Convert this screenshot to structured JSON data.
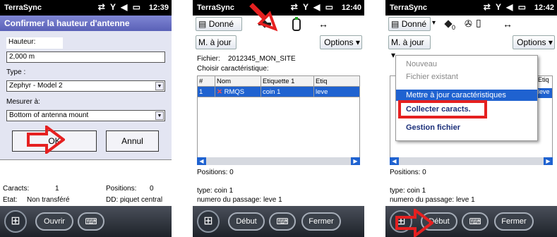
{
  "status": {
    "app": "TerraSync",
    "icons": "⇄ ᵞ ◂€",
    "times": [
      "12:39",
      "12:40",
      "12:42"
    ]
  },
  "screen1": {
    "dialog_title": "Confirmer la hauteur d'antenne",
    "hauteur_label": "Hauteur:",
    "hauteur_value": "2,000 m",
    "type_label": "Type :",
    "type_value": "Zephyr - Model 2",
    "mesurer_label": "Mesurer à:",
    "mesurer_value": "Bottom of antenna mount",
    "ok_label": "OK",
    "annul_label": "Annul",
    "caracts_label": "Caracts:",
    "caracts_value": "1",
    "positions_label": "Positions:",
    "positions_value": "0",
    "etat_label": "Etat:",
    "etat_value": "Non transféré",
    "dd_label": "DD: piquet central",
    "ouvrir_label": "Ouvrir",
    "keyboard_icon": "⌨"
  },
  "screen2": {
    "donne_label": "Donné",
    "maj_label": "M. à jour",
    "options_label": "Options",
    "fichier_label": "Fichier:",
    "fichier_value": "2012345_MON_SITE",
    "choisir_label": "Choisir caractéristique:",
    "table": {
      "headers": [
        "#",
        "Nom",
        "Etiquette 1",
        "Etiq"
      ],
      "rows": [
        [
          "1",
          "RMQS",
          "coin 1",
          "leve"
        ]
      ]
    },
    "positions_text": "Positions:  0",
    "type_text": "type: coin 1",
    "numero_text": "numero du passage: leve 1",
    "debut_label": "Début",
    "fermer_label": "Fermer"
  },
  "screen3": {
    "donne_label": "Donné",
    "maj_label": "M. à jour",
    "options_label": "Options",
    "menu": [
      "Nouveau",
      "Fichier existant",
      "Mettre à jour caractéristiques",
      "Collecter caracts.",
      "Gestion fichier"
    ],
    "etiq_label": "Etiq",
    "leve_label": "leve",
    "positions_text": "Positions:  0",
    "type_text": "type: coin 1",
    "numero_text": "numero du passage: leve 1",
    "debut_label": "Début",
    "fermer_label": "Fermer"
  },
  "colors": {
    "accent_red": "#e52020",
    "selection_blue": "#1f62d0",
    "title_blue": "#5a61b7"
  }
}
